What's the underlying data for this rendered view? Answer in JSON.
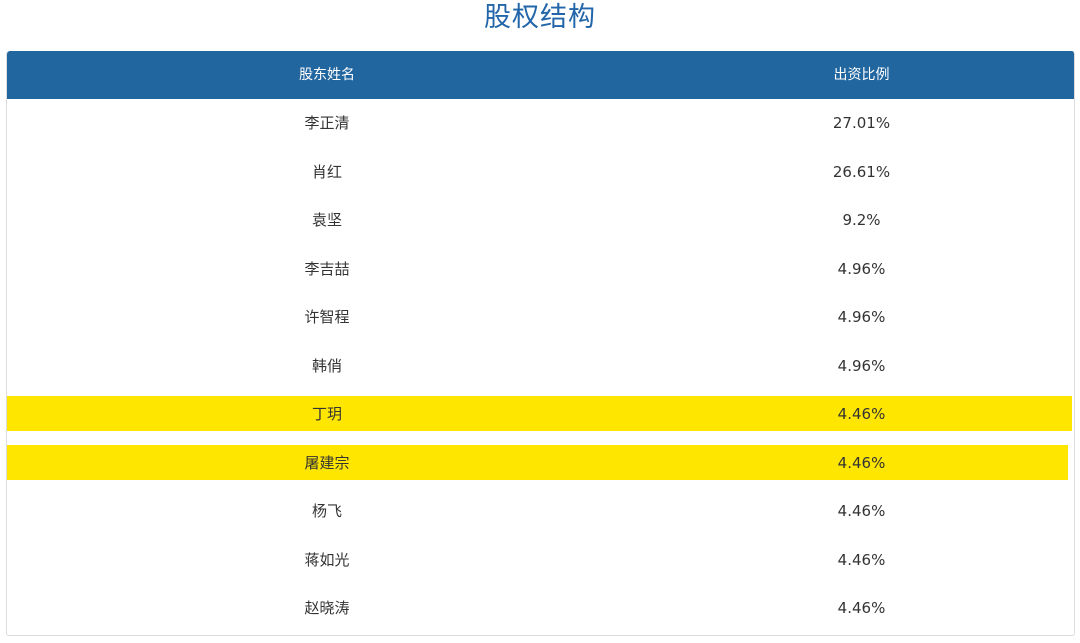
{
  "page": {
    "title": "股权结构"
  },
  "table": {
    "columns": [
      "股东姓名",
      "出资比例"
    ],
    "rows": [
      {
        "name": "李正清",
        "ratio": "27.01%"
      },
      {
        "name": "肖红",
        "ratio": "26.61%"
      },
      {
        "name": "袁坚",
        "ratio": "9.2%"
      },
      {
        "name": "李吉喆",
        "ratio": "4.96%"
      },
      {
        "name": "许智程",
        "ratio": "4.96%"
      },
      {
        "name": "韩俏",
        "ratio": "4.96%"
      },
      {
        "name": "丁玥",
        "ratio": "4.46%",
        "highlighted": true
      },
      {
        "name": "屠建宗",
        "ratio": "4.46%",
        "highlighted": true
      },
      {
        "name": "杨飞",
        "ratio": "4.46%"
      },
      {
        "name": "蒋如光",
        "ratio": "4.46%"
      },
      {
        "name": "赵晓涛",
        "ratio": "4.46%"
      }
    ]
  },
  "colors": {
    "title": "#2266a9",
    "header_bg": "#2266a0",
    "header_text": "#ffffff",
    "highlight": "#ffe600",
    "cell_text": "#333333"
  }
}
